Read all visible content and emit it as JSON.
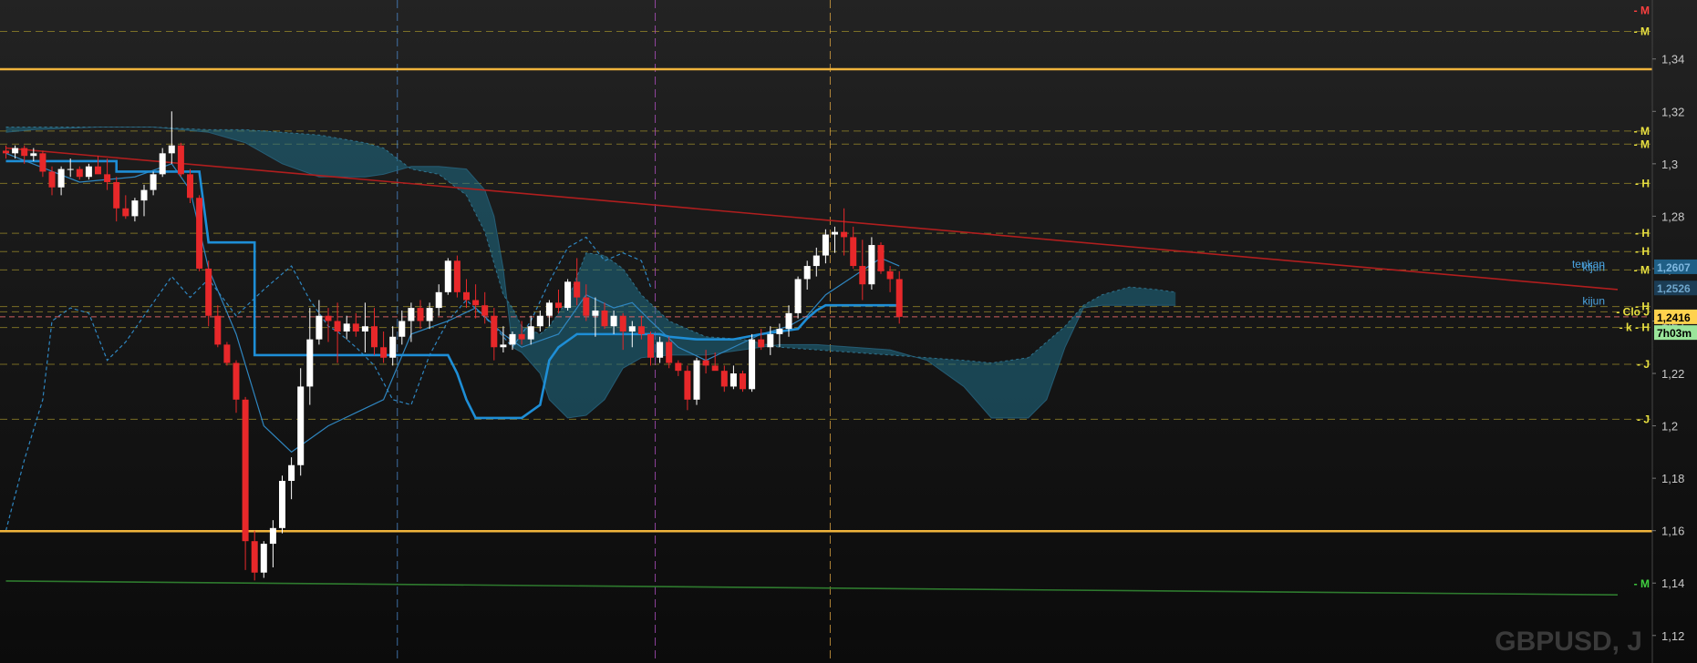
{
  "chart_data": {
    "type": "candlestick",
    "symbol_label": "GBPUSD, J",
    "timeframe": "J",
    "y_axis_ticks": [
      "1,34",
      "1,32",
      "1,3",
      "1,28",
      "1,26",
      "1,24",
      "1,22",
      "1,2",
      "1,18",
      "1,16",
      "1,14",
      "1,12"
    ],
    "ylim": [
      1.1095,
      1.3625
    ],
    "x_count": 130,
    "price_boxes": [
      {
        "label": "1,2607",
        "value": 1.2607,
        "color": "#1f5f86",
        "text": "#7fb8e0"
      },
      {
        "label": "1,2526",
        "value": 1.2526,
        "color": "#1c3d55",
        "text": "#6fa6cc"
      },
      {
        "label": "1,2416",
        "value": 1.2416,
        "color": "#ffd24d",
        "text": "#000000"
      },
      {
        "label": "7h03m",
        "value": 1.2356,
        "color": "#9ae59a",
        "text": "#000000"
      }
    ],
    "indicator_labels": [
      {
        "text": "tenkan",
        "value": 1.2617,
        "color": "#4aa3df"
      },
      {
        "text": "kijun",
        "value": 1.2605,
        "color": "#4aa3df"
      },
      {
        "text": "kijun",
        "value": 1.2476,
        "color": "#4aa3df"
      }
    ],
    "levels": [
      {
        "value": 1.3585,
        "tag": "M",
        "color": "#cc3333",
        "style": "none",
        "tag_color": "#ff4040"
      },
      {
        "value": 1.3505,
        "tag": "M",
        "color": "#9a8a2a",
        "style": "dash",
        "tag_color": "#e8e040"
      },
      {
        "value": 1.3125,
        "tag": "M",
        "color": "#9a8a2a",
        "style": "dash",
        "tag_color": "#e8e040"
      },
      {
        "value": 1.3075,
        "tag": "M",
        "color": "#9a8a2a",
        "style": "dash",
        "tag_color": "#e8e040"
      },
      {
        "value": 1.2925,
        "tag": "H",
        "color": "#9a8a2a",
        "style": "dash",
        "tag_color": "#e8e040"
      },
      {
        "value": 1.2735,
        "tag": "H",
        "color": "#9a8a2a",
        "style": "dash",
        "tag_color": "#e8e040"
      },
      {
        "value": 1.2665,
        "tag": "H",
        "color": "#9a8a2a",
        "style": "dash",
        "tag_color": "#e8e040"
      },
      {
        "value": 1.2595,
        "tag": "M",
        "color": "#9a8a2a",
        "style": "dash",
        "tag_color": "#e8e040"
      },
      {
        "value": 1.2455,
        "tag": "H",
        "color": "#9a8a2a",
        "style": "dash",
        "tag_color": "#e8e040"
      },
      {
        "value": 1.2435,
        "tag": "Clo J",
        "color": "#9a8a2a",
        "style": "dash",
        "tag_color": "#e8e040"
      },
      {
        "value": 1.2375,
        "tag": "k - H",
        "color": "#9a8a2a",
        "style": "dash",
        "tag_color": "#e8e040"
      },
      {
        "value": 1.2235,
        "tag": "J",
        "color": "#9a8a2a",
        "style": "dash",
        "tag_color": "#e8e040"
      },
      {
        "value": 1.2025,
        "tag": "J",
        "color": "#9a8a2a",
        "style": "dash",
        "tag_color": "#e8e040"
      },
      {
        "value": 1.1398,
        "tag": "M",
        "color": "#2e7a2e",
        "style": "none",
        "tag_color": "#40d040"
      }
    ],
    "horizontal_lines": [
      {
        "value": 1.3361,
        "color": "#f0b43c"
      },
      {
        "value": 1.1598,
        "color": "#f0b43c"
      },
      {
        "value": 1.2416,
        "color": "#ff7070",
        "dash": true
      }
    ],
    "trend_lines": [
      {
        "from": [
          0,
          1.306
        ],
        "to": [
          175,
          1.252
        ],
        "color": "#b01e1e"
      },
      {
        "from": [
          0,
          1.1408
        ],
        "to": [
          175,
          1.1355
        ],
        "color": "#2e7a2e"
      }
    ],
    "vertical_lines": [
      {
        "x": 42.5,
        "color": "#4a86c8"
      },
      {
        "x": 70.5,
        "color": "#b050c0"
      },
      {
        "x": 89.5,
        "color": "#d8a040"
      }
    ],
    "candles": [
      [
        1.305,
        1.307,
        1.302,
        1.304
      ],
      [
        1.304,
        1.307,
        1.302,
        1.306
      ],
      [
        1.306,
        1.307,
        1.3,
        1.303
      ],
      [
        1.303,
        1.306,
        1.301,
        1.304
      ],
      [
        1.304,
        1.305,
        1.295,
        1.297
      ],
      [
        1.297,
        1.299,
        1.288,
        1.291
      ],
      [
        1.291,
        1.299,
        1.288,
        1.298
      ],
      [
        1.298,
        1.302,
        1.295,
        1.298
      ],
      [
        1.298,
        1.299,
        1.294,
        1.295
      ],
      [
        1.295,
        1.3,
        1.294,
        1.299
      ],
      [
        1.299,
        1.303,
        1.297,
        1.296
      ],
      [
        1.296,
        1.302,
        1.29,
        1.293
      ],
      [
        1.293,
        1.295,
        1.278,
        1.283
      ],
      [
        1.283,
        1.288,
        1.279,
        1.28
      ],
      [
        1.28,
        1.287,
        1.278,
        1.286
      ],
      [
        1.286,
        1.292,
        1.28,
        1.29
      ],
      [
        1.29,
        1.297,
        1.288,
        1.296
      ],
      [
        1.296,
        1.306,
        1.295,
        1.304
      ],
      [
        1.304,
        1.32,
        1.3,
        1.307
      ],
      [
        1.307,
        1.308,
        1.295,
        1.296
      ],
      [
        1.296,
        1.298,
        1.285,
        1.287
      ],
      [
        1.287,
        1.288,
        1.259,
        1.26
      ],
      [
        1.26,
        1.263,
        1.238,
        1.242
      ],
      [
        1.242,
        1.246,
        1.23,
        1.231
      ],
      [
        1.231,
        1.232,
        1.223,
        1.224
      ],
      [
        1.224,
        1.225,
        1.205,
        1.21
      ],
      [
        1.21,
        1.211,
        1.145,
        1.156
      ],
      [
        1.156,
        1.16,
        1.141,
        1.144
      ],
      [
        1.144,
        1.156,
        1.142,
        1.155
      ],
      [
        1.155,
        1.164,
        1.146,
        1.161
      ],
      [
        1.161,
        1.181,
        1.159,
        1.179
      ],
      [
        1.179,
        1.188,
        1.172,
        1.185
      ],
      [
        1.185,
        1.222,
        1.181,
        1.215
      ],
      [
        1.215,
        1.245,
        1.208,
        1.233
      ],
      [
        1.233,
        1.248,
        1.231,
        1.242
      ],
      [
        1.242,
        1.245,
        1.232,
        1.24
      ],
      [
        1.24,
        1.247,
        1.224,
        1.236
      ],
      [
        1.236,
        1.242,
        1.233,
        1.239
      ],
      [
        1.239,
        1.243,
        1.234,
        1.236
      ],
      [
        1.236,
        1.247,
        1.228,
        1.238
      ],
      [
        1.238,
        1.245,
        1.227,
        1.23
      ],
      [
        1.23,
        1.236,
        1.224,
        1.226
      ],
      [
        1.226,
        1.238,
        1.223,
        1.234
      ],
      [
        1.234,
        1.244,
        1.231,
        1.24
      ],
      [
        1.24,
        1.247,
        1.232,
        1.245
      ],
      [
        1.245,
        1.248,
        1.237,
        1.24
      ],
      [
        1.24,
        1.247,
        1.237,
        1.245
      ],
      [
        1.245,
        1.254,
        1.242,
        1.251
      ],
      [
        1.251,
        1.264,
        1.25,
        1.263
      ],
      [
        1.263,
        1.265,
        1.249,
        1.251
      ],
      [
        1.251,
        1.256,
        1.245,
        1.248
      ],
      [
        1.248,
        1.254,
        1.241,
        1.246
      ],
      [
        1.246,
        1.251,
        1.239,
        1.242
      ],
      [
        1.242,
        1.245,
        1.225,
        1.23
      ],
      [
        1.23,
        1.238,
        1.228,
        1.231
      ],
      [
        1.231,
        1.236,
        1.229,
        1.235
      ],
      [
        1.235,
        1.24,
        1.231,
        1.233
      ],
      [
        1.233,
        1.242,
        1.231,
        1.238
      ],
      [
        1.238,
        1.244,
        1.236,
        1.242
      ],
      [
        1.242,
        1.248,
        1.238,
        1.247
      ],
      [
        1.247,
        1.252,
        1.243,
        1.245
      ],
      [
        1.245,
        1.256,
        1.244,
        1.255
      ],
      [
        1.255,
        1.264,
        1.246,
        1.249
      ],
      [
        1.249,
        1.254,
        1.24,
        1.242
      ],
      [
        1.242,
        1.249,
        1.234,
        1.244
      ],
      [
        1.244,
        1.247,
        1.237,
        1.238
      ],
      [
        1.238,
        1.244,
        1.235,
        1.242
      ],
      [
        1.242,
        1.243,
        1.229,
        1.236
      ],
      [
        1.236,
        1.24,
        1.23,
        1.238
      ],
      [
        1.238,
        1.242,
        1.233,
        1.235
      ],
      [
        1.235,
        1.236,
        1.223,
        1.226
      ],
      [
        1.226,
        1.234,
        1.224,
        1.232
      ],
      [
        1.232,
        1.234,
        1.222,
        1.224
      ],
      [
        1.224,
        1.225,
        1.219,
        1.221
      ],
      [
        1.221,
        1.223,
        1.206,
        1.21
      ],
      [
        1.21,
        1.226,
        1.208,
        1.225
      ],
      [
        1.225,
        1.229,
        1.22,
        1.223
      ],
      [
        1.223,
        1.228,
        1.222,
        1.221
      ],
      [
        1.221,
        1.223,
        1.213,
        1.215
      ],
      [
        1.215,
        1.223,
        1.214,
        1.22
      ],
      [
        1.22,
        1.221,
        1.213,
        1.214
      ],
      [
        1.214,
        1.235,
        1.213,
        1.233
      ],
      [
        1.233,
        1.237,
        1.229,
        1.23
      ],
      [
        1.23,
        1.238,
        1.227,
        1.235
      ],
      [
        1.235,
        1.239,
        1.23,
        1.237
      ],
      [
        1.237,
        1.246,
        1.234,
        1.243
      ],
      [
        1.243,
        1.257,
        1.241,
        1.256
      ],
      [
        1.256,
        1.263,
        1.252,
        1.261
      ],
      [
        1.261,
        1.268,
        1.257,
        1.265
      ],
      [
        1.265,
        1.275,
        1.262,
        1.273
      ],
      [
        1.273,
        1.276,
        1.266,
        1.274
      ],
      [
        1.274,
        1.283,
        1.265,
        1.272
      ],
      [
        1.272,
        1.276,
        1.26,
        1.261
      ],
      [
        1.261,
        1.271,
        1.248,
        1.254
      ],
      [
        1.254,
        1.272,
        1.252,
        1.269
      ],
      [
        1.269,
        1.27,
        1.258,
        1.259
      ],
      [
        1.259,
        1.261,
        1.251,
        1.256
      ],
      [
        1.256,
        1.259,
        1.239,
        1.2416
      ]
    ],
    "kijun": [
      [
        0,
        1.301
      ],
      [
        12,
        1.301
      ],
      [
        12,
        1.297
      ],
      [
        21,
        1.297
      ],
      [
        22,
        1.27
      ],
      [
        27,
        1.27
      ],
      [
        27,
        1.227
      ],
      [
        48,
        1.227
      ],
      [
        49,
        1.22
      ],
      [
        50,
        1.21
      ],
      [
        51,
        1.203
      ],
      [
        53,
        1.203
      ],
      [
        56,
        1.203
      ],
      [
        58,
        1.208
      ],
      [
        59,
        1.225
      ],
      [
        60,
        1.23
      ],
      [
        62,
        1.235
      ],
      [
        71,
        1.235
      ],
      [
        72,
        1.234
      ],
      [
        75,
        1.233
      ],
      [
        79,
        1.233
      ],
      [
        82,
        1.235
      ],
      [
        86,
        1.237
      ],
      [
        87,
        1.241
      ],
      [
        88,
        1.244
      ],
      [
        89,
        1.246
      ],
      [
        96,
        1.246
      ],
      [
        96,
        1.246
      ],
      [
        97,
        1.246
      ]
    ],
    "tenkan": [
      [
        0,
        1.304
      ],
      [
        8,
        1.293
      ],
      [
        14,
        1.295
      ],
      [
        18,
        1.3
      ],
      [
        20,
        1.29
      ],
      [
        22,
        1.26
      ],
      [
        25,
        1.235
      ],
      [
        28,
        1.2
      ],
      [
        31,
        1.19
      ],
      [
        33,
        1.195
      ],
      [
        35,
        1.2
      ],
      [
        38,
        1.205
      ],
      [
        41,
        1.21
      ],
      [
        44,
        1.235
      ],
      [
        48,
        1.24
      ],
      [
        51,
        1.245
      ],
      [
        54,
        1.235
      ],
      [
        56,
        1.23
      ],
      [
        60,
        1.235
      ],
      [
        63,
        1.25
      ],
      [
        66,
        1.245
      ],
      [
        68,
        1.247
      ],
      [
        70,
        1.24
      ],
      [
        73,
        1.23
      ],
      [
        76,
        1.225
      ],
      [
        79,
        1.23
      ],
      [
        82,
        1.235
      ],
      [
        85,
        1.238
      ],
      [
        87,
        1.242
      ],
      [
        89,
        1.25
      ],
      [
        92,
        1.257
      ],
      [
        95,
        1.264
      ],
      [
        97,
        1.261
      ]
    ],
    "chikou": [
      [
        0,
        1.16
      ],
      [
        2,
        1.187
      ],
      [
        4,
        1.21
      ],
      [
        5,
        1.24
      ],
      [
        7,
        1.245
      ],
      [
        9,
        1.243
      ],
      [
        11,
        1.225
      ],
      [
        13,
        1.232
      ],
      [
        15,
        1.242
      ],
      [
        18,
        1.257
      ],
      [
        20,
        1.249
      ],
      [
        22,
        1.256
      ],
      [
        25,
        1.242
      ],
      [
        28,
        1.252
      ],
      [
        31,
        1.261
      ],
      [
        33,
        1.248
      ],
      [
        35,
        1.238
      ],
      [
        36,
        1.236
      ],
      [
        38,
        1.23
      ],
      [
        40,
        1.223
      ],
      [
        42,
        1.21
      ],
      [
        44,
        1.208
      ],
      [
        46,
        1.227
      ],
      [
        48,
        1.24
      ],
      [
        50,
        1.248
      ],
      [
        53,
        1.238
      ],
      [
        55,
        1.23
      ],
      [
        57,
        1.24
      ],
      [
        59,
        1.255
      ],
      [
        61,
        1.268
      ],
      [
        63,
        1.272
      ],
      [
        65,
        1.263
      ],
      [
        67,
        1.266
      ],
      [
        69,
        1.263
      ],
      [
        70,
        1.253
      ]
    ],
    "cloud": [
      [
        0,
        1.314,
        1.312
      ],
      [
        3,
        1.314,
        1.313
      ],
      [
        10,
        1.314,
        1.314
      ],
      [
        16,
        1.314,
        1.314
      ],
      [
        22,
        1.313,
        1.312
      ],
      [
        26,
        1.313,
        1.308
      ],
      [
        30,
        1.312,
        1.3
      ],
      [
        34,
        1.311,
        1.295
      ],
      [
        39,
        1.308,
        1.295
      ],
      [
        41,
        1.306,
        1.296
      ],
      [
        44,
        1.298,
        1.299
      ],
      [
        47,
        1.296,
        1.299
      ],
      [
        50,
        1.288,
        1.298
      ],
      [
        52,
        1.274,
        1.29
      ],
      [
        53,
        1.262,
        1.28
      ],
      [
        54,
        1.25,
        1.26
      ],
      [
        55,
        1.245,
        1.23
      ],
      [
        56,
        1.238,
        1.228
      ],
      [
        58,
        1.235,
        1.22
      ],
      [
        59,
        1.238,
        1.21
      ],
      [
        61,
        1.248,
        1.203
      ],
      [
        63,
        1.266,
        1.204
      ],
      [
        65,
        1.265,
        1.21
      ],
      [
        67,
        1.26,
        1.222
      ],
      [
        69,
        1.25,
        1.226
      ],
      [
        72,
        1.24,
        1.227
      ],
      [
        76,
        1.234,
        1.227
      ],
      [
        80,
        1.233,
        1.229
      ],
      [
        84,
        1.23,
        1.231
      ],
      [
        88,
        1.229,
        1.231
      ],
      [
        92,
        1.228,
        1.23
      ],
      [
        96,
        1.227,
        1.229
      ],
      [
        100,
        1.226,
        1.225
      ],
      [
        104,
        1.225,
        1.215
      ],
      [
        107,
        1.224,
        1.203
      ],
      [
        111,
        1.226,
        1.203
      ],
      [
        113,
        1.232,
        1.21
      ],
      [
        115,
        1.238,
        1.23
      ],
      [
        117,
        1.246,
        1.245
      ],
      [
        119,
        1.25,
        1.246
      ],
      [
        122,
        1.253,
        1.246
      ],
      [
        125,
        1.252,
        1.246
      ],
      [
        127,
        1.251,
        1.246
      ]
    ]
  }
}
